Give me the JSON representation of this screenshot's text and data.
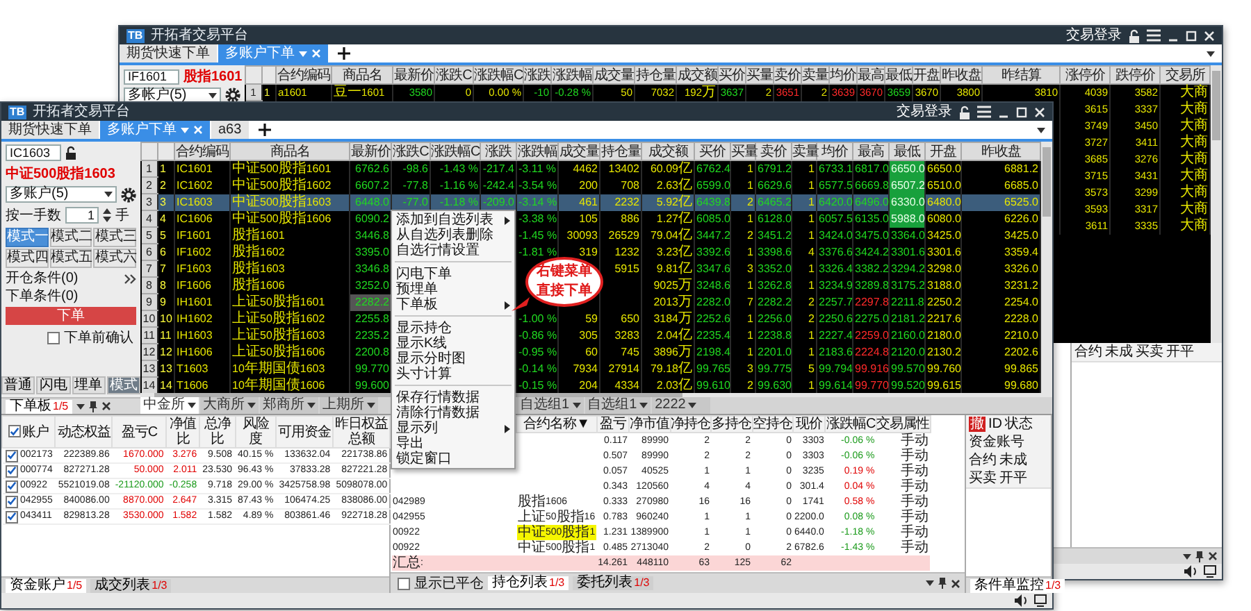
{
  "back_window": {
    "logo": "TB",
    "title": "开拓者交易平台",
    "login": "交易登录",
    "tabs": [
      {
        "label": "期货快速下单",
        "selected": false
      },
      {
        "label": "多账户下单",
        "selected": true
      }
    ],
    "order_panel": {
      "contract_code": "IF1601",
      "contract_name": "股指1601",
      "account": "多帐户(5)"
    },
    "quotes": {
      "columns": [
        "合约编码",
        "商品名",
        "最新价",
        "涨跌C",
        "涨跌幅C",
        "涨跌",
        "涨跌幅",
        "成交量",
        "持仓量",
        "成交额",
        "买价",
        "买量",
        "卖价",
        "卖量",
        "均价",
        "最高",
        "最低",
        "开盘",
        "昨收盘",
        "昨结算",
        "涨停价",
        "跌停价",
        "交易所"
      ],
      "rows": [
        {
          "row_number": "1",
          "index": "1",
          "selected": false,
          "cells": [
            "a1601",
            "豆一1601",
            "3580",
            "0",
            "0.00 %",
            "-10",
            "-0.28 %",
            "50",
            "7032",
            "192万",
            "3637",
            "2",
            "3651",
            "2",
            "3639",
            "3670",
            "3659",
            "3670",
            "3800",
            "3810",
            "4039",
            "3582",
            "大商"
          ]
        },
        {
          "selected": false,
          "cells": [
            "3615",
            "3337",
            "大商"
          ]
        },
        {
          "selected": false,
          "cells": [
            "3749",
            "3450",
            "大商"
          ]
        },
        {
          "selected": false,
          "cells": [
            "3727",
            "3411",
            "大商"
          ]
        },
        {
          "selected": false,
          "cells": [
            "3685",
            "3276",
            "大商"
          ]
        },
        {
          "selected": false,
          "cells": [
            "3715",
            "3431",
            "大商"
          ]
        },
        {
          "selected": false,
          "cells": [
            "3573",
            "3299",
            "大商"
          ]
        },
        {
          "selected": false,
          "cells": [
            "3593",
            "3317",
            "大商"
          ]
        },
        {
          "selected": false,
          "cells": [
            "3611",
            "3335",
            "大商"
          ]
        }
      ]
    },
    "order_columns": [
      "合约",
      "未成",
      "买卖",
      "开平"
    ]
  },
  "front_window": {
    "logo": "TB",
    "title": "开拓者交易平台",
    "login": "交易登录",
    "tabs": [
      {
        "label": "期货快速下单",
        "selected": false
      },
      {
        "label": "多账户下单",
        "selected": true
      },
      {
        "label": "a63",
        "selected": false
      }
    ],
    "order_panel": {
      "contract_code": "IC1603",
      "contract_name": "中证500股指1603",
      "account": "多账户(5)",
      "quantity_label": "按一手数",
      "quantity": "1",
      "unit": "手",
      "modes": [
        {
          "label": "模式一",
          "selected": true
        },
        {
          "label": "模式二",
          "selected": false
        },
        {
          "label": "模式三",
          "selected": false
        },
        {
          "label": "模式四",
          "selected": false
        },
        {
          "label": "模式五",
          "selected": false
        },
        {
          "label": "模式六",
          "selected": false
        }
      ],
      "conditions": [
        "开仓条件(0)",
        "下单条件(0)"
      ],
      "submit": "下单",
      "confirm": {
        "label": "下单前确认",
        "checked": false
      },
      "styles": [
        {
          "label": "普通",
          "selected": false
        },
        {
          "label": "闪电",
          "selected": false
        },
        {
          "label": "埋单",
          "selected": false
        },
        {
          "label": "模式",
          "selected": true
        }
      ],
      "pane_tab": {
        "label": "下单板",
        "count": "1/5"
      }
    },
    "quotes": {
      "columns": [
        "合约编码",
        "商品名",
        "最新价",
        "涨跌C",
        "涨跌幅C",
        "涨跌",
        "涨跌幅",
        "成交量",
        "持仓量",
        "成交额",
        "买价",
        "买量",
        "卖价",
        "卖量",
        "均价",
        "最高",
        "最低",
        "开盘",
        "昨收盘"
      ],
      "rows": [
        {
          "row_number": "1",
          "index": "1",
          "selected": false,
          "cells": [
            "IC1601",
            "中证500股指1601",
            "6762.6",
            "-98.6",
            "-1.43 %",
            "-217.4",
            "-3.11 %",
            "4462",
            "13402",
            "60.09亿",
            "6762.4",
            "1",
            "6791.2",
            "1",
            "6733.1",
            "6817.0",
            {
              "text": "6650.0",
              "highlighted": true
            },
            "6650.0",
            "6881.2"
          ]
        },
        {
          "row_number": "2",
          "index": "2",
          "selected": false,
          "cells": [
            "IC1602",
            "中证500股指1602",
            "6607.2",
            "-77.8",
            "-1.16 %",
            "-242.4",
            "-3.54 %",
            "200",
            "708",
            "2.63亿",
            "6599.0",
            "1",
            "6629.6",
            "1",
            "6577.5",
            "6669.8",
            {
              "text": "6507.2",
              "highlighted": true
            },
            "6510.0",
            "6685.0"
          ]
        },
        {
          "row_number": "3",
          "index": "3",
          "selected": true,
          "cells": [
            "IC1603",
            "中证500股指1603",
            "6448.0",
            "-77.0",
            "-1.18 %",
            "-209.0",
            "-3.14 %",
            "461",
            "2232",
            "5.92亿",
            "6439.8",
            "2",
            "6465.2",
            "1",
            "6420.0",
            "6496.0",
            {
              "text": "6330.0",
              "highlighted": true
            },
            "6480.0",
            "6525.0"
          ]
        },
        {
          "row_number": "4",
          "index": "4",
          "selected": false,
          "cells": [
            "IC1606",
            "中证500股指1606",
            "6090.2",
            null,
            null,
            null,
            "-3.38 %",
            "105",
            "886",
            "1.27亿",
            "6085.0",
            "1",
            "6128.0",
            "1",
            "6057.5",
            "6135.0",
            {
              "text": "5988.0",
              "highlighted": true
            },
            "6080.0",
            "6226.0"
          ]
        },
        {
          "row_number": "5",
          "index": "5",
          "selected": false,
          "cells": [
            "IF1601",
            "股指1601",
            "3446.8",
            null,
            null,
            null,
            "-1.45 %",
            "30093",
            "26529",
            "79.04亿",
            "3447.2",
            "2",
            "3451.2",
            "1",
            "3424.0",
            "3475.0",
            "3364.0",
            "3425.0",
            "3425.0"
          ]
        },
        {
          "row_number": "6",
          "index": "6",
          "selected": false,
          "cells": [
            "IF1602",
            "股指1602",
            "3395.0",
            null,
            null,
            null,
            "-1.81 %",
            "319",
            "1232",
            "3.23亿",
            "3392.6",
            "1",
            "3398.6",
            "4",
            "3376.6",
            "3424.2",
            "3301.6",
            "3301.6",
            "3359.4"
          ]
        },
        {
          "row_number": "7",
          "index": "7",
          "selected": false,
          "cells": [
            "IF1603",
            "股指1603",
            "3346.8",
            null,
            null,
            null,
            null,
            null,
            "5915",
            "9.81亿",
            "3347.6",
            "3",
            "3352.0",
            "1",
            "3326.4",
            "3382.2",
            "3294.2",
            "3298.0",
            "3326.0"
          ]
        },
        {
          "row_number": "8",
          "index": "8",
          "selected": false,
          "cells": [
            "IF1606",
            "股指1606",
            "3252.0",
            null,
            null,
            null,
            null,
            null,
            null,
            "9025万",
            "3248.6",
            "1",
            "3262.8",
            "1",
            "3234.9",
            "3289.8",
            "3175.2",
            "3188.0",
            "3231.2"
          ]
        },
        {
          "row_number": "9",
          "index": "9",
          "selected": false,
          "cells": [
            "IH1601",
            "上证50股指1601",
            {
              "text": "2282.2",
              "focused": true
            },
            null,
            null,
            null,
            null,
            null,
            null,
            "2013万",
            "2282.0",
            "7",
            "2282.2",
            "2",
            "2257.7",
            {
              "text": "2297.8",
              "rising": true
            },
            "2211.8",
            "2250.2",
            "2254.0"
          ]
        },
        {
          "row_number": "10",
          "index": "10",
          "selected": false,
          "cells": [
            "IH1602",
            "上证50股指1602",
            "2255.8",
            null,
            null,
            null,
            "-1.00 %",
            "59",
            "650",
            "3184万",
            "2252.6",
            "1",
            "2256.0",
            "2",
            "2250.6",
            "2275.0",
            "2181.2",
            "2217.6",
            "2228.0"
          ]
        },
        {
          "row_number": "11",
          "index": "11",
          "selected": false,
          "cells": [
            "IH1603",
            "上证50股指1603",
            "2235.2",
            null,
            null,
            null,
            "-0.86 %",
            "305",
            "3283",
            "2.04亿",
            "2235.4",
            "1",
            "2238.8",
            "1",
            "2227.4",
            {
              "text": "2259.0",
              "rising": true
            },
            "2160.0",
            "2180.0",
            "2210.0"
          ]
        },
        {
          "row_number": "12",
          "index": "12",
          "selected": false,
          "cells": [
            "IH1606",
            "上证50股指1606",
            "2200.8",
            null,
            null,
            null,
            "-0.95 %",
            "60",
            "745",
            "3896万",
            "2198.4",
            "1",
            "2201.0",
            "1",
            "2183.6",
            {
              "text": "2224.8",
              "rising": true
            },
            "2120.0",
            "2130.2",
            "2202.6"
          ]
        },
        {
          "row_number": "13",
          "index": "13",
          "selected": false,
          "cells": [
            "T1603",
            "10年期国债1603",
            "99.770",
            null,
            null,
            null,
            "-0.14 %",
            "7934",
            "27914",
            "79.18亿",
            "99.765",
            "3",
            "99.775",
            "5",
            "99.794",
            {
              "text": "99.916",
              "rising": true
            },
            "99.570",
            "99.760",
            "99.865"
          ]
        },
        {
          "row_number": "14",
          "index": "14",
          "selected": false,
          "cells": [
            "T1606",
            "10年期国债1606",
            "99.600",
            null,
            null,
            null,
            "-0.15 %",
            "204",
            "4334",
            "2.03亿",
            "99.610",
            "2",
            "99.630",
            "1",
            "99.614",
            {
              "text": "99.770",
              "rising": true
            },
            "99.520",
            "99.615",
            "99.680"
          ]
        }
      ]
    },
    "quote_tabs": [
      {
        "label": "中金所",
        "selected": true
      },
      {
        "label": "大商所",
        "selected": false
      },
      {
        "label": "郑商所",
        "selected": false
      },
      {
        "label": "上期所",
        "selected": false
      },
      {
        "label": "自选组1",
        "selected": false
      },
      {
        "label": "自选组1",
        "selected": false
      },
      {
        "label": "2222",
        "selected": false
      }
    ],
    "context_menu": [
      {
        "kind": "item",
        "label": "添加到自选列表",
        "submenu": true
      },
      {
        "kind": "item",
        "label": "从自选列表删除",
        "submenu": false
      },
      {
        "kind": "item",
        "label": "自选行情设置",
        "submenu": false
      },
      {
        "kind": "separator"
      },
      {
        "kind": "item",
        "label": "闪电下单",
        "submenu": false
      },
      {
        "kind": "item",
        "label": "预埋单",
        "submenu": false
      },
      {
        "kind": "item",
        "label": "下单板",
        "submenu": true
      },
      {
        "kind": "separator"
      },
      {
        "kind": "item",
        "label": "显示持仓",
        "submenu": false
      },
      {
        "kind": "item",
        "label": "显示K线",
        "submenu": false
      },
      {
        "kind": "item",
        "label": "显示分时图",
        "submenu": false
      },
      {
        "kind": "item",
        "label": "头寸计算",
        "submenu": false
      },
      {
        "kind": "separator"
      },
      {
        "kind": "item",
        "label": "保存行情数据",
        "submenu": false
      },
      {
        "kind": "item",
        "label": "清除行情数据",
        "submenu": false
      },
      {
        "kind": "item",
        "label": "显示列",
        "submenu": true
      },
      {
        "kind": "item",
        "label": "导出",
        "submenu": false
      },
      {
        "kind": "item",
        "label": "锁定窗口",
        "submenu": false
      }
    ],
    "callout": {
      "lines": [
        "右键菜单",
        "直接下单"
      ]
    },
    "accounts": {
      "all_checked": true,
      "columns": [
        "账户",
        "动态权益",
        "盈亏C",
        "净值比",
        "总净比",
        "风险度",
        "可用资金",
        "昨日权益总额"
      ],
      "rows": [
        {
          "checked": true,
          "cells": [
            "002173",
            "222389.86",
            {
              "text": "1670.000",
              "rising": true
            },
            {
              "text": "3.276",
              "rising": true
            },
            "9.508",
            "40.15 %",
            "133632.04",
            "221738.86"
          ]
        },
        {
          "checked": true,
          "cells": [
            "000774",
            "827271.28",
            {
              "text": "50.000",
              "rising": true
            },
            {
              "text": "2.011",
              "rising": true
            },
            "23.530",
            "96.43 %",
            "37833.28",
            "827221.28"
          ]
        },
        {
          "checked": true,
          "cells": [
            "00922",
            "5521019.08",
            {
              "text": "-21120.000",
              "rising": false
            },
            {
              "text": "-0.258",
              "rising": false
            },
            "9.718",
            "29.00 %",
            "3425758.98",
            "5098078.00"
          ]
        },
        {
          "checked": true,
          "cells": [
            "042955",
            "840086.00",
            {
              "text": "8870.000",
              "rising": true
            },
            {
              "text": "2.647",
              "rising": true
            },
            "3.315",
            "87.43 %",
            "106474.25",
            "838086.00"
          ]
        },
        {
          "checked": true,
          "cells": [
            "043411",
            "829813.28",
            {
              "text": "3530.000",
              "rising": true
            },
            {
              "text": "1.582",
              "rising": true
            },
            "1.582",
            "4.89 %",
            "803861.46",
            "922718.28"
          ]
        }
      ],
      "tabs": [
        {
          "label": "资金账户",
          "count": "1/5",
          "selected": true
        },
        {
          "label": "成交列表",
          "count": "1/3",
          "selected": false
        }
      ]
    },
    "positions": {
      "columns": [
        null,
        "合约名称▼",
        "盈亏",
        "净市值",
        "净持仓",
        "多持仓",
        "空持仓",
        "现价",
        "涨跌幅C",
        "交易属性"
      ],
      "rows": [
        {
          "kind": "position",
          "cells": [
            null,
            null,
            "0.117",
            "89990",
            "2",
            "2",
            "0",
            "3303",
            {
              "text": "-0.06 %",
              "rising": false
            },
            "手动"
          ]
        },
        {
          "kind": "position",
          "cells": [
            null,
            null,
            "0.507",
            "89990",
            "2",
            "2",
            "0",
            "3303",
            {
              "text": "-0.06 %",
              "rising": false
            },
            "手动"
          ]
        },
        {
          "kind": "position",
          "cells": [
            null,
            null,
            "0.057",
            "40525",
            "1",
            "1",
            "0",
            "3235",
            {
              "text": "0.19 %",
              "rising": true
            },
            "手动"
          ]
        },
        {
          "kind": "position",
          "cells": [
            null,
            null,
            "0.343",
            "120560",
            "4",
            "4",
            "0",
            "301.4",
            {
              "text": "0.04 %",
              "rising": true
            },
            "手动"
          ]
        },
        {
          "kind": "position",
          "cells": [
            "042989",
            "股指1606",
            "0.333",
            "270980",
            "16",
            "16",
            "0",
            "1741",
            {
              "text": "0.58 %",
              "rising": true
            },
            "手动"
          ]
        },
        {
          "kind": "position",
          "cells": [
            "042955",
            "上证50股指16",
            "0.783",
            "960240",
            "1",
            "1",
            "0",
            "2200.0",
            {
              "text": "0.08 %",
              "rising": false
            },
            "手动"
          ]
        },
        {
          "kind": "position",
          "cells": [
            "00922",
            {
              "text": "中证500股指1",
              "highlighted": true
            },
            "1.231",
            "1389900",
            "1",
            "1",
            "0",
            "6440.0",
            {
              "text": "-1.18 %",
              "rising": false
            },
            "手动"
          ]
        },
        {
          "kind": "position",
          "cells": [
            "00922",
            "中证500股指1",
            "0.485",
            "2713040",
            "2",
            "0",
            "2",
            "6782.6",
            {
              "text": "-1.43 %",
              "rising": false
            },
            "手动"
          ]
        },
        {
          "kind": "summary",
          "cells": [
            "汇总:",
            null,
            "14.261",
            "448110",
            "63",
            "125",
            "62",
            null,
            null,
            null
          ]
        }
      ],
      "show_closed": {
        "label": "显示已平仓",
        "checked": false
      },
      "tabs": [
        {
          "label": "持仓列表",
          "count": "1/3",
          "selected": true
        },
        {
          "label": "委托列表",
          "count": "1/3",
          "selected": false
        }
      ]
    },
    "orders": {
      "columns": [
        {
          "label": "撤",
          "kind": "action"
        },
        {
          "label": "ID",
          "kind": "text"
        },
        {
          "label": "状态",
          "kind": "text"
        },
        {
          "label": "资金账号",
          "kind": "text"
        },
        {
          "label": "合约",
          "kind": "text"
        },
        {
          "label": "未成",
          "kind": "text"
        },
        {
          "label": "买卖",
          "kind": "text"
        },
        {
          "label": "开平",
          "kind": "text"
        }
      ],
      "tabs": [
        {
          "label": "条件单监控",
          "count": "1/3",
          "selected": true
        }
      ]
    }
  }
}
